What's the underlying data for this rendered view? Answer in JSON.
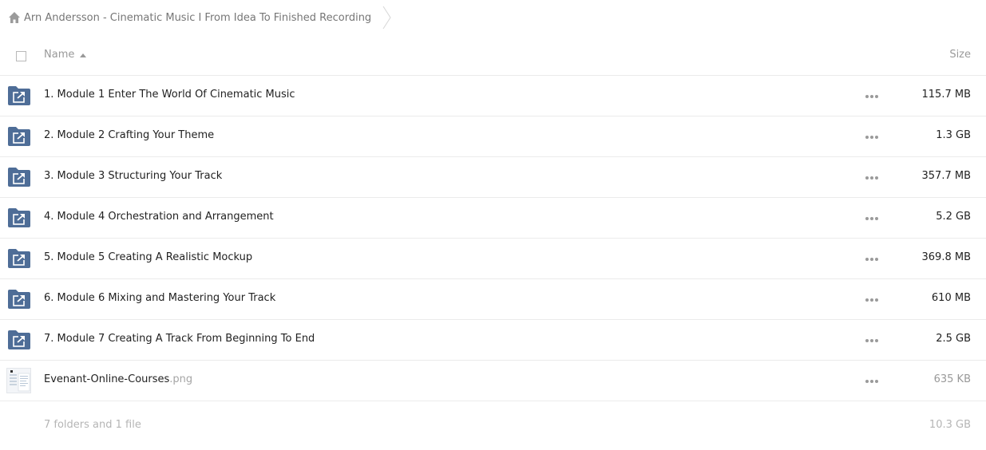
{
  "breadcrumb": {
    "icon": "home-icon",
    "title": "Arn Andersson - Cinematic Music I From Idea To Finished Recording"
  },
  "header": {
    "name_label": "Name",
    "size_label": "Size",
    "sort": "ascending"
  },
  "colors": {
    "folder": "#4e6d97",
    "text": "#222222",
    "muted": "#999999",
    "divider": "#ebebeb"
  },
  "rows": [
    {
      "name": "1. Module 1 Enter The World Of Cinematic Music",
      "size": "115.7 MB",
      "icon": "shared-folder-icon"
    },
    {
      "name": "2. Module 2 Crafting Your Theme",
      "size": "1.3 GB",
      "icon": "shared-folder-icon"
    },
    {
      "name": "3. Module 3 Structuring Your Track",
      "size": "357.7 MB",
      "icon": "shared-folder-icon"
    },
    {
      "name": "4. Module 4 Orchestration and Arrangement",
      "size": "5.2 GB",
      "icon": "shared-folder-icon"
    },
    {
      "name": "5. Module 5 Creating A Realistic Mockup",
      "size": "369.8 MB",
      "icon": "shared-folder-icon"
    },
    {
      "name": "6. Module 6 Mixing and Mastering Your Track",
      "size": "610 MB",
      "icon": "shared-folder-icon"
    },
    {
      "name": "7. Module 7 Creating A Track From Beginning To End",
      "size": "2.5 GB",
      "icon": "shared-folder-icon"
    }
  ],
  "file": {
    "name": "Evenant-Online-Courses",
    "ext": ".png",
    "size": "635 KB",
    "icon": "image-thumbnail"
  },
  "summary": {
    "count": "7 folders and 1 file",
    "total": "10.3 GB"
  }
}
